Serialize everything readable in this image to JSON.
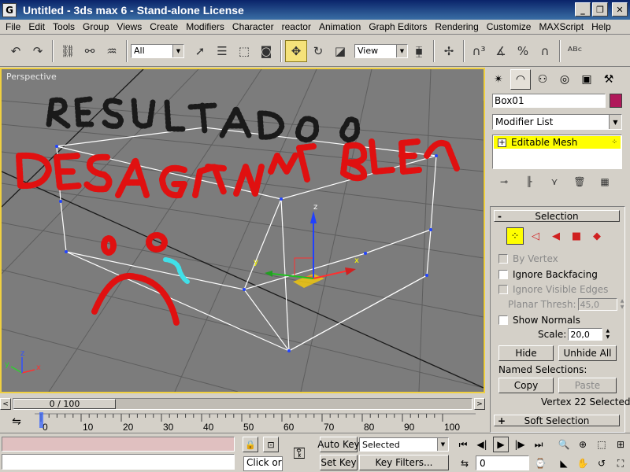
{
  "window": {
    "title": "Untitled  - 3ds max 6 - Stand-alone License",
    "app_icon": "G",
    "minimize_glyph": "_",
    "maximize_glyph": "❐",
    "close_glyph": "✕"
  },
  "menu": [
    "File",
    "Edit",
    "Tools",
    "Group",
    "Views",
    "Create",
    "Modifiers",
    "Character",
    "reactor",
    "Animation",
    "Graph Editors",
    "Rendering",
    "Customize",
    "MAXScript",
    "Help"
  ],
  "toolbar": {
    "selection_filter": "All",
    "reference_coord": "View"
  },
  "viewport": {
    "label": "Perspective",
    "gizmo_axes": {
      "x": "x",
      "y": "y",
      "z": "z"
    },
    "corner_axes": {
      "x": "x",
      "y": "y",
      "z": "z"
    },
    "colors": {
      "background": "#7c7c7c",
      "grid": "#5e5e5e",
      "black_line": "#1a1a1a",
      "wire": "#ffffff",
      "paint_red": "#e01010",
      "paint_black": "#1a1a1a",
      "paint_cyan": "#40e0e8"
    }
  },
  "time_slider": {
    "frame_display": "0 / 100",
    "prev_glyph": "<",
    "next_glyph": ">"
  },
  "trackbar": {
    "ticks": [
      "0",
      "10",
      "20",
      "30",
      "40",
      "50",
      "60",
      "70",
      "80",
      "90",
      "100"
    ]
  },
  "status": {
    "prompt_text": "Click or cl",
    "auto_key": "Auto Key",
    "set_key": "Set Key",
    "key_mode": "Selected",
    "key_filters": "Key Filters...",
    "current_frame": "0"
  },
  "command_panel": {
    "object_name": "Box01",
    "object_color": "#b0185a",
    "modifier_list": "Modifier List",
    "stack_items": [
      {
        "label": "Editable Mesh"
      }
    ],
    "selection_rollout": {
      "title": "Selection",
      "toggle": "-",
      "by_vertex": "By Vertex",
      "ignore_backfacing": "Ignore Backfacing",
      "ignore_visible_edges": "Ignore Visible Edges",
      "planar_thresh_label": "Planar Thresh:",
      "planar_thresh_value": "45,0",
      "show_normals": "Show Normals",
      "scale_label": "Scale:",
      "scale_value": "20,0",
      "hide": "Hide",
      "unhide_all": "Unhide All",
      "named_selections": "Named Selections:",
      "copy": "Copy",
      "paste": "Paste",
      "status": "Vertex 22 Selected"
    },
    "soft_selection_rollout": {
      "title": "Soft Selection",
      "toggle": "+"
    }
  }
}
